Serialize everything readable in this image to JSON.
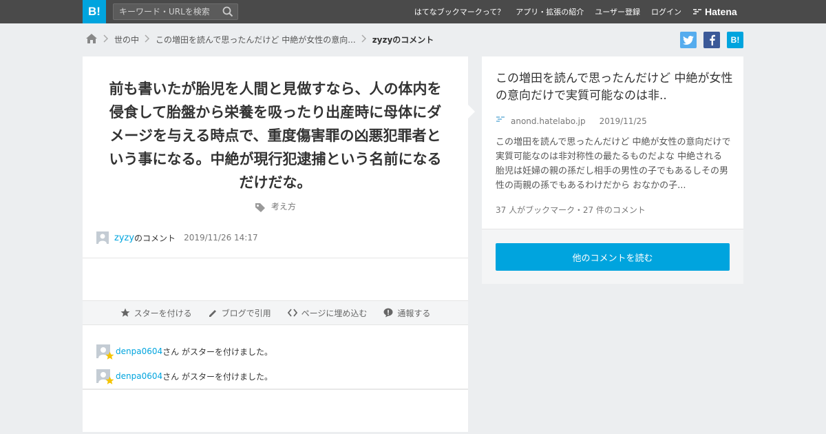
{
  "header": {
    "logo": "B!",
    "search_placeholder": "キーワード・URLを検索",
    "nav": [
      "はてなブックマークって？",
      "アプリ・拡張の紹介",
      "ユーザー登録",
      "ログイン"
    ],
    "brand": "Hatena"
  },
  "breadcrumb": {
    "items": [
      "世の中",
      "この増田を読んで思ったんだけど 中絶が女性の意向..."
    ],
    "current": "zyzyのコメント"
  },
  "share": {
    "twitter": "t",
    "facebook": "f",
    "hatena": "B!"
  },
  "comment": {
    "text": "前も書いたが胎児を人間と見做すなら、人の体内を侵食して胎盤から栄養を吸ったり出産時に母体にダメージを与える時点で、重度傷害罪の凶悪犯罪者という事になる。中絶が現行犯逮捕という名前になるだけだな。",
    "tag": "考え方",
    "user": "zyzy",
    "user_suffix": "のコメント",
    "date": "2019/11/26 14:17"
  },
  "actions": {
    "star": "スターを付ける",
    "blog": "ブログで引用",
    "embed": "ページに埋め込む",
    "report": "通報する"
  },
  "stars": [
    {
      "user": "denpa0604",
      "text": "さん がスターを付けました。"
    },
    {
      "user": "denpa0604",
      "text": "さん がスターを付けました。"
    }
  ],
  "entry": {
    "title": "この増田を読んで思ったんだけど 中絶が女性の意向だけで実質可能なのは非..",
    "domain": "anond.hatelabo.jp",
    "date": "2019/11/25",
    "excerpt": "この増田を読んで思ったんだけど 中絶が女性の意向だけで実質可能なのは非対称性の最たるものだよな 中絶される胎児は妊婦の親の孫だし相手の男性の子でもあるしその男性の両親の孫でもあるわけだから おなかの子...",
    "counts": "37 人がブックマーク・27 件のコメント",
    "read_button": "他のコメントを読む"
  },
  "colors": {
    "accent": "#00a4de",
    "topbar": "#4a4a4a",
    "star": "#f5c400"
  }
}
